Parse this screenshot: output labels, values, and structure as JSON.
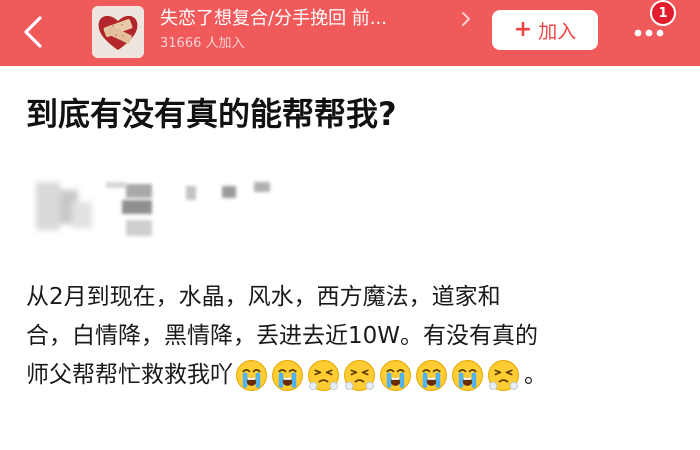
{
  "header": {
    "back_icon": "chevron-left-icon",
    "group_name": "失恋了想复合/分手挽回 前...",
    "member_count": "31666 人加入",
    "title_chevron_icon": "chevron-right-icon",
    "join_plus": "+",
    "join_label": "加入",
    "more_icon": "more-dots-icon",
    "notification_badge": "1",
    "colors": {
      "bar": "#f05a5a",
      "badge": "#e11d2e",
      "join_text": "#ef4444"
    }
  },
  "post": {
    "title": "到底有没有真的能帮帮我?",
    "body_lines": [
      "从2月到现在，水晶，风水，西方魔法，道家和",
      "合，白情降，黑情降，丢进去近10W。有没有真的",
      "师父帮帮忙救救我吖"
    ],
    "trailing_emojis": [
      "crying-face",
      "crying-face",
      "steam-face",
      "steam-face",
      "crying-face",
      "crying-face",
      "crying-face",
      "steam-face"
    ],
    "period": "。"
  }
}
